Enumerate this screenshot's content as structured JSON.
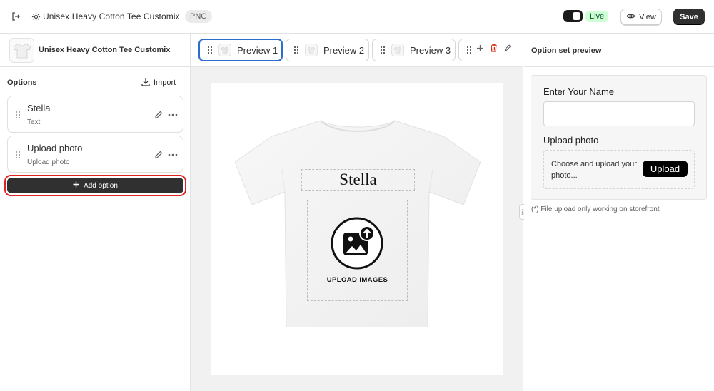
{
  "topbar": {
    "app_title": "Unisex Heavy Cotton Tee Customix",
    "format_badge": "PNG",
    "live_badge": "Live",
    "view_label": "View",
    "save_label": "Save"
  },
  "left_panel": {
    "product_name": "Unisex Heavy Cotton Tee Customix",
    "options_title": "Options",
    "import_label": "Import",
    "options": [
      {
        "title": "Stella",
        "subtitle": "Text"
      },
      {
        "title": "Upload photo",
        "subtitle": "Upload photo"
      }
    ],
    "add_option_label": "Add option"
  },
  "preview_tabs": [
    {
      "label": "Preview 1",
      "active": true
    },
    {
      "label": "Preview 2",
      "active": false
    },
    {
      "label": "Preview 3",
      "active": false
    }
  ],
  "canvas": {
    "text_layer": "Stella",
    "image_placeholder_caption": "UPLOAD IMAGES"
  },
  "right_panel": {
    "title": "Option set preview",
    "name_label": "Enter Your Name",
    "name_value": "",
    "upload_label": "Upload photo",
    "upload_hint": "Choose and upload your photo...",
    "upload_button": "Upload",
    "note": "(*) File upload only working on storefront"
  },
  "colors": {
    "accent_active_tab": "#2c6ecb",
    "primary_button": "#303030",
    "live_badge_bg": "#cdfed4",
    "highlight_outline": "#e02424",
    "delete_icon": "#d72c0d"
  },
  "icons": [
    "exit-icon",
    "gear-icon",
    "eye-icon",
    "import-icon",
    "drag-handle-icon",
    "pencil-icon",
    "more-horizontal-icon",
    "plus-icon",
    "trash-icon"
  ]
}
